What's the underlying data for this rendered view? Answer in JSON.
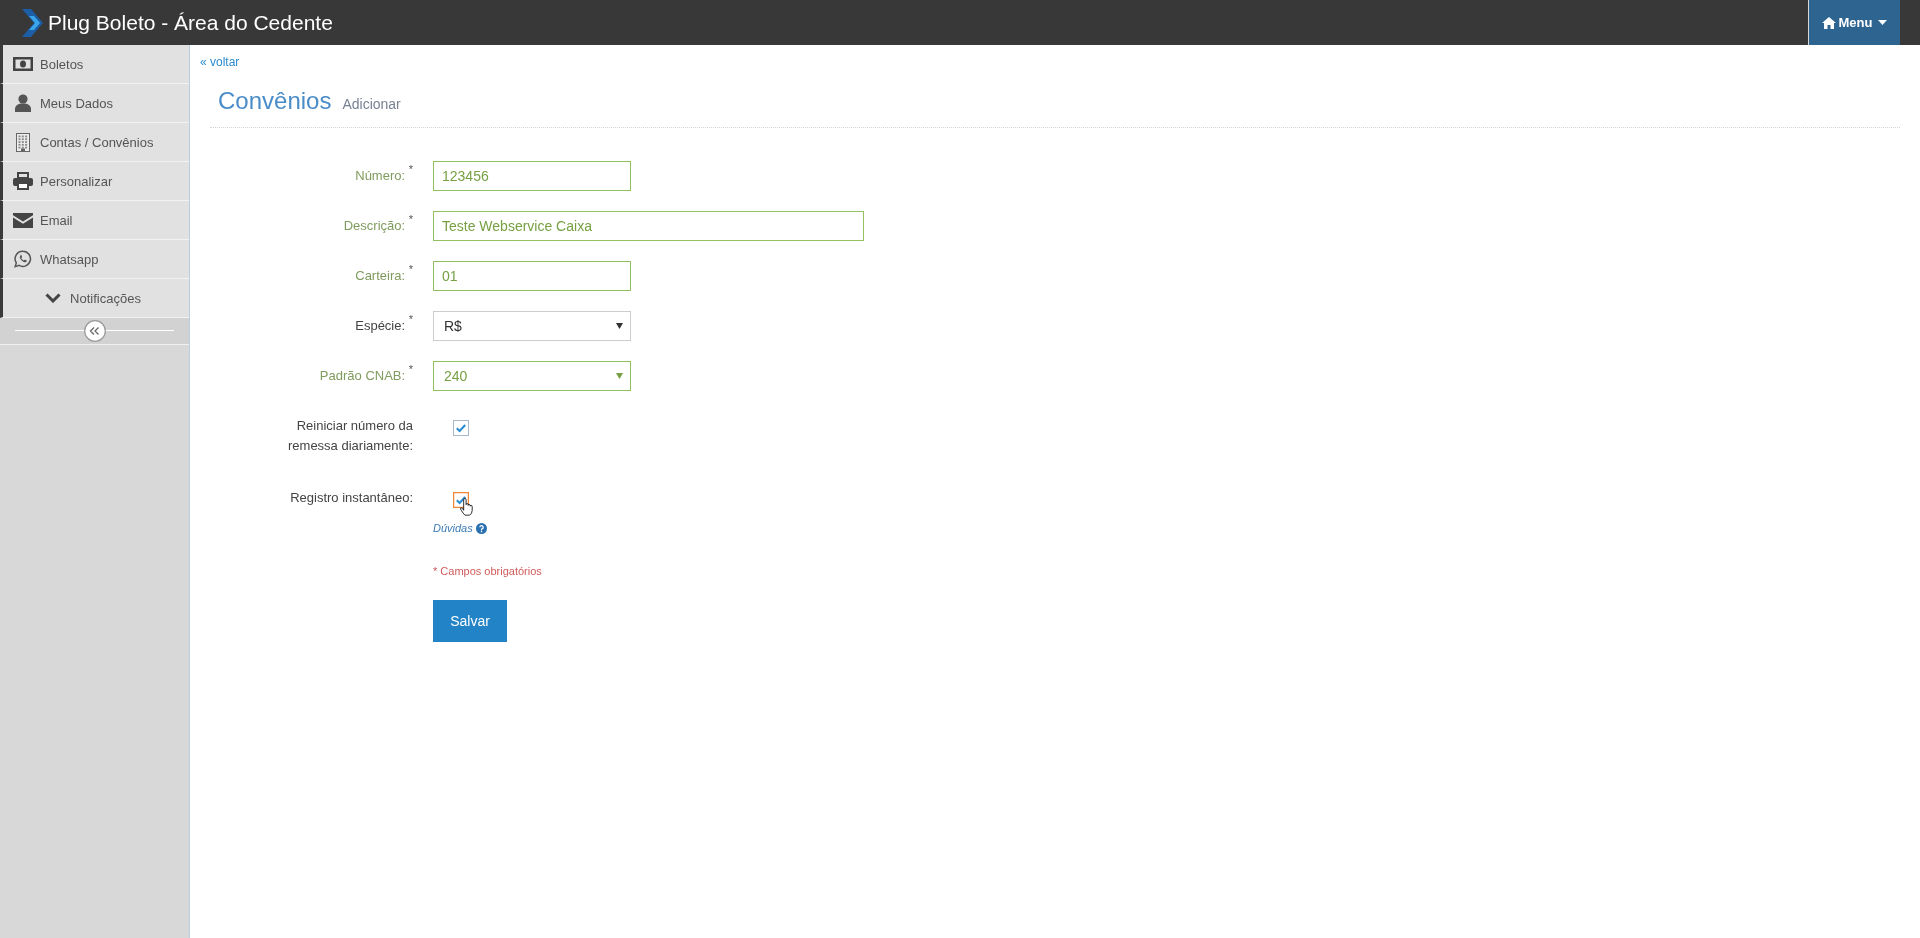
{
  "topbar": {
    "title": "Plug Boleto - Área do Cedente",
    "menu_button": {
      "label": "Menu"
    }
  },
  "sidebar": {
    "items": [
      {
        "label": "Boletos",
        "kind": "link"
      },
      {
        "label": "Meus Dados",
        "kind": "link"
      },
      {
        "label": "Contas / Convênios",
        "kind": "link"
      },
      {
        "label": "Personalizar",
        "kind": "link"
      },
      {
        "label": "Email",
        "kind": "link"
      },
      {
        "label": "Whatsapp",
        "kind": "link"
      },
      {
        "label": "Notificações",
        "kind": "group"
      }
    ]
  },
  "back_link": "« voltar",
  "page_header": {
    "title": "Convênios",
    "subtitle": "Adicionar"
  },
  "form": {
    "fields": [
      {
        "kind": "input",
        "label": "Número: $^{*}$",
        "value": "123456",
        "valid": true
      },
      {
        "kind": "wide",
        "label": "Descrição: $^{*}$",
        "value": "Teste Webservice Caixa",
        "valid": true
      },
      {
        "kind": "input",
        "label": "Carteira: $^{*}$",
        "value": "01",
        "valid": true
      },
      {
        "kind": "select",
        "label": "Espécie: $^{*}$",
        "value": "R$",
        "valid": false
      },
      {
        "kind": "select",
        "label": "Padrão CNAB: $^{*}$",
        "value": "240",
        "valid": true
      },
      {
        "kind": "checkbox",
        "label": "Reiniciar número da remessa diariamente:",
        "checked": true,
        "focused": false
      },
      {
        "kind": "checkbox",
        "label": "Registro instantâneo:",
        "checked": true,
        "focused": true,
        "help_link": "Dúvidas"
      }
    ],
    "required_note": "* Campos obrigatórios",
    "submit_button": "Salvar"
  }
}
